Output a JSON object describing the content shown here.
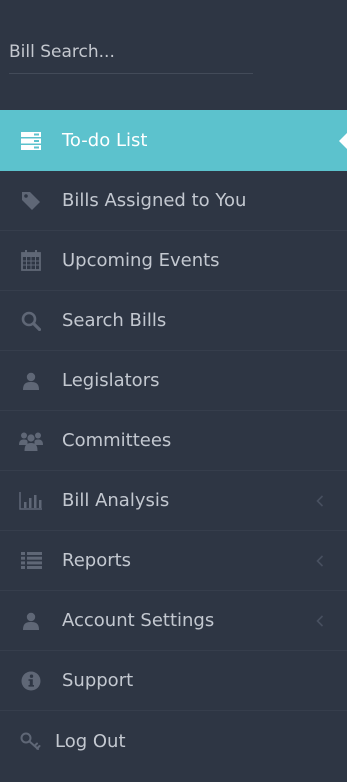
{
  "search": {
    "placeholder": "Bill Search..."
  },
  "menu": {
    "items": [
      {
        "label": "To-do List",
        "icon": "todo-list-icon",
        "active": true
      },
      {
        "label": "Bills Assigned to You",
        "icon": "tag-icon"
      },
      {
        "label": "Upcoming Events",
        "icon": "calendar-icon"
      },
      {
        "label": "Search Bills",
        "icon": "search-icon"
      },
      {
        "label": "Legislators",
        "icon": "user-icon"
      },
      {
        "label": "Committees",
        "icon": "users-icon"
      },
      {
        "label": "Bill Analysis",
        "icon": "bar-chart-icon",
        "submenu": true
      },
      {
        "label": "Reports",
        "icon": "list-icon",
        "submenu": true
      },
      {
        "label": "Account Settings",
        "icon": "user-icon",
        "submenu": true
      },
      {
        "label": "Support",
        "icon": "info-icon"
      },
      {
        "label": "Log Out",
        "icon": "key-icon"
      }
    ]
  },
  "colors": {
    "sidebar_bg": "#2e3644",
    "active_bg": "#5cc2cd",
    "text": "#c3c8d0",
    "icon": "#5f6776"
  }
}
